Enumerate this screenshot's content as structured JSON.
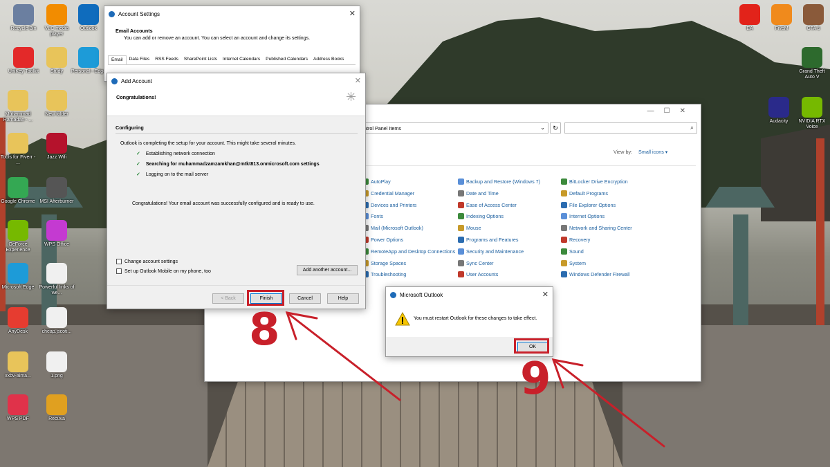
{
  "desktop": {
    "left_icons": [
      {
        "label": "Recycle Bin",
        "icon": "recycle-bin-icon",
        "color": "#6b7fa0"
      },
      {
        "label": "VLC media player",
        "icon": "vlc-icon",
        "color": "#f28c00"
      },
      {
        "label": "Outlook",
        "icon": "outlook-icon",
        "color": "#0f6cbd"
      },
      {
        "label": "UniKey Toolkit",
        "icon": "unikey-icon",
        "color": "#e32929"
      },
      {
        "label": "Study",
        "icon": "folder-icon",
        "color": "#e8c45a"
      },
      {
        "label": "Personal - Edge",
        "icon": "edge-icon",
        "color": "#1d9bd8"
      },
      {
        "label": "Muhammad Ramadan - ...",
        "icon": "folder-icon",
        "color": "#e8c45a"
      },
      {
        "label": "New folder",
        "icon": "folder-icon",
        "color": "#e8c45a"
      },
      {
        "label": "Tools for Fiverr - ...",
        "icon": "folder-icon",
        "color": "#e8c45a"
      },
      {
        "label": "Jazz Wifi",
        "icon": "jazz-icon",
        "color": "#b5122c"
      },
      {
        "label": "Google Chrome",
        "icon": "chrome-icon",
        "color": "#34a853"
      },
      {
        "label": "MSI Afterburner",
        "icon": "msi-icon",
        "color": "#555555"
      },
      {
        "label": "GeForce Experience",
        "icon": "geforce-icon",
        "color": "#76b900"
      },
      {
        "label": "WPS Office",
        "icon": "wps-icon",
        "color": "#c43ad1"
      },
      {
        "label": "Microsoft Edge",
        "icon": "edge-icon",
        "color": "#1d9bd8"
      },
      {
        "label": "Powerful links of we...",
        "icon": "document-icon",
        "color": "#f0f0f0"
      },
      {
        "label": "AnyDesk",
        "icon": "anydesk-icon",
        "color": "#e63c30"
      },
      {
        "label": "cheap.jscoti...",
        "icon": "document-icon",
        "color": "#f0f0f0"
      },
      {
        "label": "xxbv-aima...",
        "icon": "folder-icon",
        "color": "#e8c45a"
      },
      {
        "label": "1.png",
        "icon": "image-icon",
        "color": "#f0f0f0"
      },
      {
        "label": "WPS PDF",
        "icon": "wps-pdf-icon",
        "color": "#e0324a"
      },
      {
        "label": "Recuva",
        "icon": "recuva-icon",
        "color": "#e0a020"
      }
    ],
    "right_icons": [
      {
        "label": "EA",
        "icon": "ea-icon",
        "color": "#e2231a"
      },
      {
        "label": "FiveM",
        "icon": "fivem-icon",
        "color": "#f08a1c"
      },
      {
        "label": "GTA 5",
        "icon": "gta-icon",
        "color": "#8a5a3a"
      },
      {
        "label": "Grand Theft Auto V",
        "icon": "gta-v-icon",
        "color": "#2d6a2d"
      },
      {
        "label": "Audacity",
        "icon": "audacity-icon",
        "color": "#2a2a8a"
      },
      {
        "label": "NVIDIA RTX Voice",
        "icon": "nvidia-icon",
        "color": "#76b900"
      }
    ]
  },
  "account_settings": {
    "title": "Account Settings",
    "heading": "Email Accounts",
    "description": "You can add or remove an account. You can select an account and change its settings.",
    "tabs": [
      "Email",
      "Data Files",
      "RSS Feeds",
      "SharePoint Lists",
      "Internet Calendars",
      "Published Calendars",
      "Address Books"
    ]
  },
  "add_account": {
    "title": "Add Account",
    "congrats_heading": "Congratulations!",
    "section": "Configuring",
    "status": "Outlook is completing the setup for your account. This might take several minutes.",
    "steps": [
      {
        "text": "Establishing network connection",
        "bold": false
      },
      {
        "text": "Searching for muhammadzamzamkhan@mtkt813.onmicrosoft.com settings",
        "bold": true
      },
      {
        "text": "Logging on to the mail server",
        "bold": false
      }
    ],
    "success": "Congratulations! Your email account was successfully configured and is ready to use.",
    "change_settings": "Change account settings",
    "setup_mobile": "Set up Outlook Mobile on my phone, too",
    "add_another": "Add another account...",
    "back": "< Back",
    "finish": "Finish",
    "cancel": "Cancel",
    "help": "Help"
  },
  "control_panel": {
    "address": "ntrol Panel Items",
    "view_by_label": "View by:",
    "view_by_value": "Small icons",
    "columns": [
      [
        "AutoPlay",
        "Credential Manager",
        "Devices and Printers",
        "Fonts",
        "Mail (Microsoft Outlook)",
        "Power Options",
        "RemoteApp and Desktop Connections",
        "Storage Spaces",
        "Troubleshooting"
      ],
      [
        "Backup and Restore (Windows 7)",
        "Date and Time",
        "Ease of Access Center",
        "Indexing Options",
        "Mouse",
        "Programs and Features",
        "Security and Maintenance",
        "Sync Center",
        "User Accounts"
      ],
      [
        "BitLocker Drive Encryption",
        "Default Programs",
        "File Explorer Options",
        "Internet Options",
        "Network and Sharing Center",
        "Recovery",
        "Sound",
        "System",
        "Windows Defender Firewall"
      ]
    ]
  },
  "outlook_dialog": {
    "title": "Microsoft Outlook",
    "message": "You must restart Outlook for these changes to take effect.",
    "ok": "OK"
  },
  "annotations": {
    "step8": "8",
    "step9": "9",
    "color": "#c8202a"
  }
}
